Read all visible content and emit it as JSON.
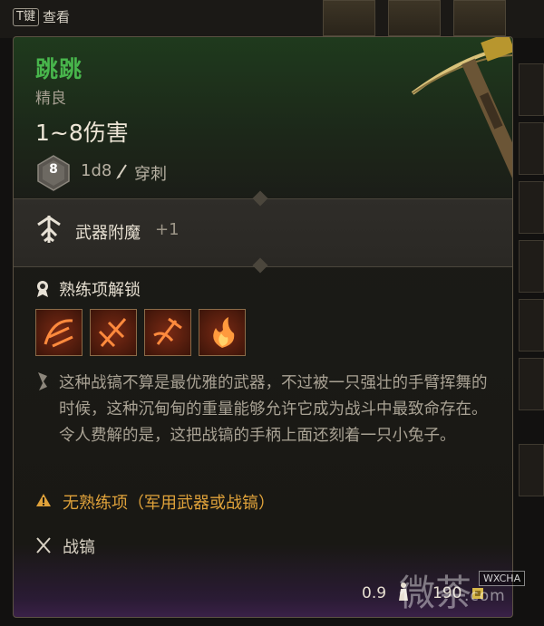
{
  "hotkey": {
    "key": "T键",
    "label": "查看"
  },
  "item": {
    "name": "跳跳",
    "rarity": "精良",
    "damage": "1~8伤害",
    "die_face": "8",
    "dice": "1d8",
    "damage_type": "穿刺",
    "enchant_label": "武器附魔",
    "enchant_value": "+1",
    "proficiency_label": "熟练项解锁",
    "actions": [
      "sweep-action-icon",
      "smash-action-icon",
      "chop-action-icon",
      "fire-action-icon"
    ],
    "description": "这种战镐不算是最优雅的武器，不过被一只强壮的手臂挥舞的时候，这种沉甸甸的重量能够允许它成为战斗中最致命存在。令人费解的是，这把战镐的手柄上面还刻着一只小兔子。",
    "warning": "无熟练项（军用武器或战镐）",
    "weapon_type": "战镐",
    "weight": "0.9",
    "price": "190"
  },
  "watermark": {
    "logo": "微茶",
    "badge": "WXCHA",
    "url": ".com"
  },
  "colors": {
    "title": "#48b64c",
    "warning": "#e0a23a",
    "border": "#5b5243"
  }
}
